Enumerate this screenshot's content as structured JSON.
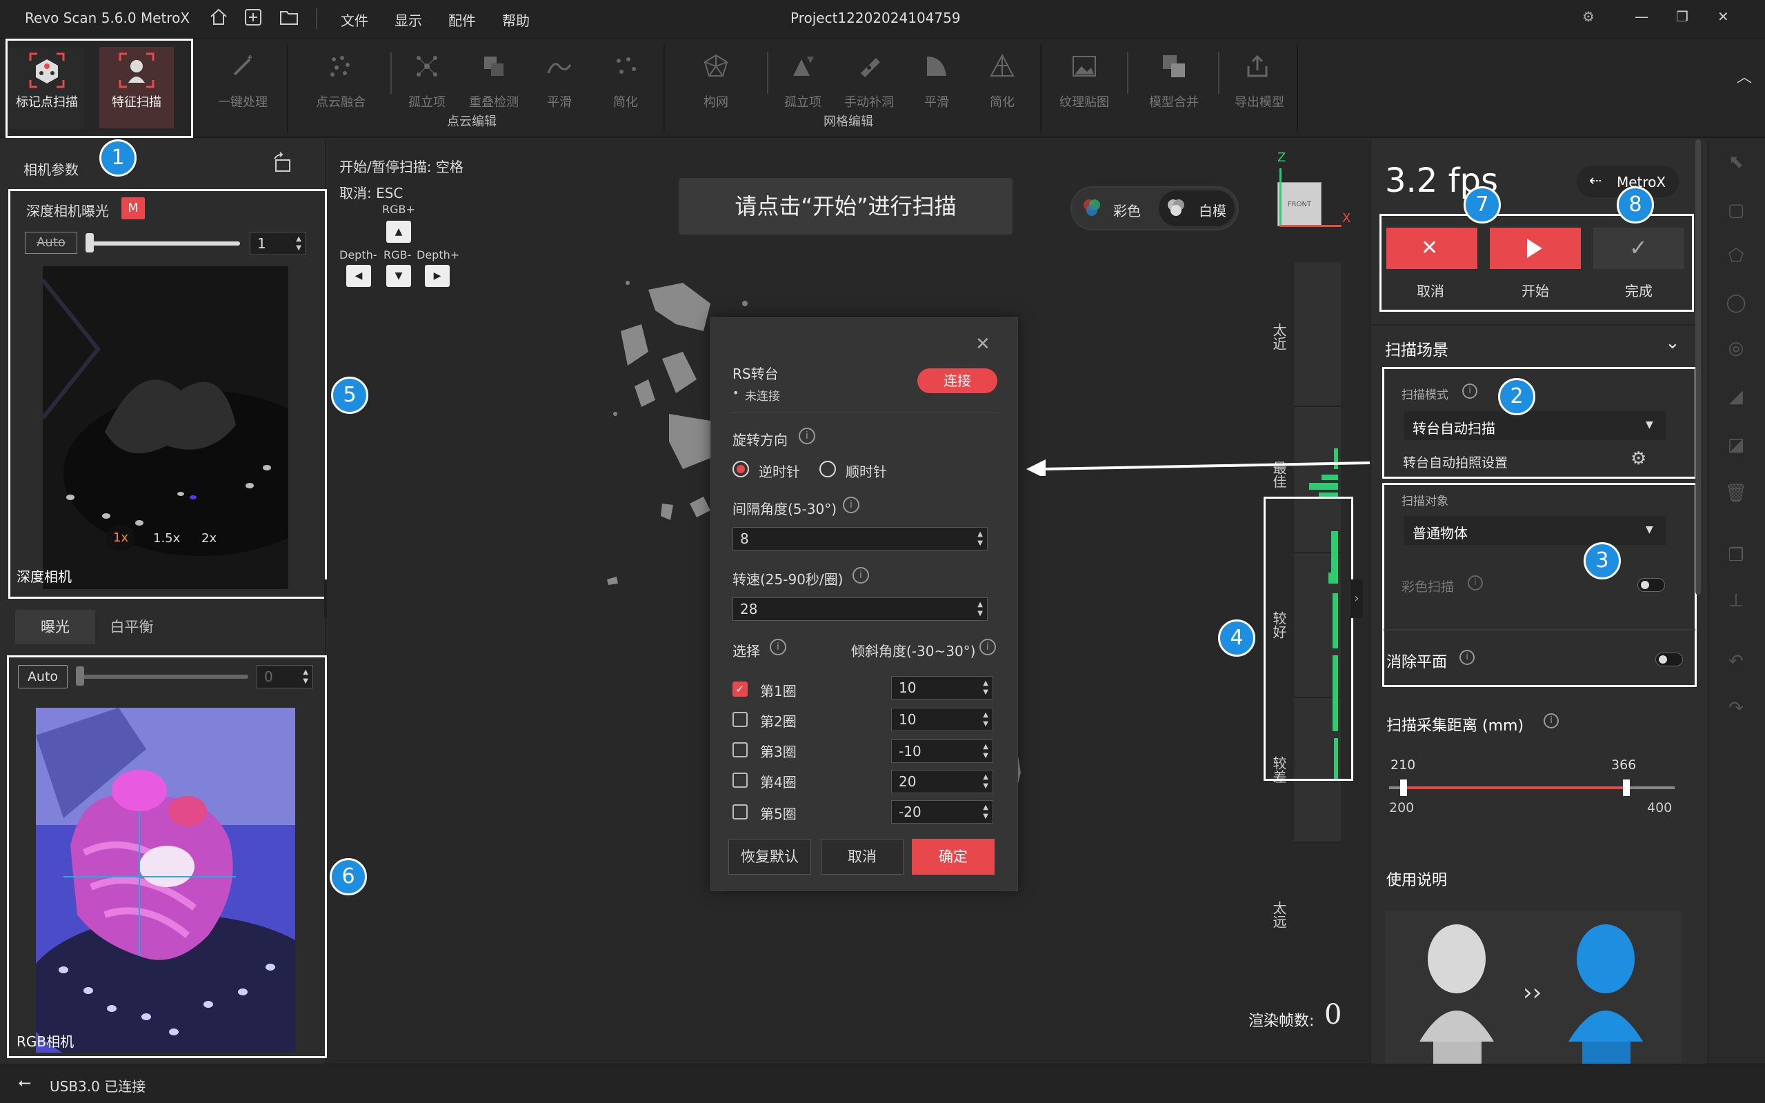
{
  "titlebar": {
    "app_title": "Revo Scan 5.6.0 MetroX",
    "menu": [
      "文件",
      "显示",
      "配件",
      "帮助"
    ],
    "project": "Project12202024104759",
    "win_controls": [
      "⚙",
      "—",
      "❐",
      "✕"
    ]
  },
  "ribbon": {
    "scan_modes": [
      "标记点扫描",
      "特征扫描"
    ],
    "one_click": "一键处理",
    "point_cloud_tools": [
      "点云融合",
      "孤立项",
      "重叠检测",
      "平滑",
      "简化"
    ],
    "point_cloud_group": "点云编辑",
    "mesh_tools": [
      "构网",
      "孤立项",
      "手动补洞",
      "平滑",
      "简化"
    ],
    "mesh_group": "网格编辑",
    "texture": "纹理贴图",
    "merge": "模型合并",
    "export": "导出模型"
  },
  "left": {
    "camera_params": "相机参数",
    "depth_exposure": "深度相机曝光",
    "m_badge": "M",
    "auto_label": "Auto",
    "depth_value": "1",
    "zoom_options": [
      "1x",
      "1.5x",
      "2x"
    ],
    "depth_camera": "深度相机",
    "tab_exposure": "曝光",
    "tab_wb": "白平衡",
    "rgb_auto": "Auto",
    "rgb_value": "0",
    "rgb_camera": "RGB相机"
  },
  "viewport": {
    "start_pause": "开始/暂停扫描: 空格",
    "cancel_hint": "取消:  ESC",
    "rgb_plus": "RGB+",
    "depth_minus": "Depth-",
    "rgb_minus": "RGB-",
    "depth_plus": "Depth+",
    "prompt": "请点击“开始”进行扫描",
    "color_mode": "彩色",
    "white_mode": "白模",
    "front": "FRONT",
    "axis_z": "Z",
    "axis_x": "X",
    "dist_labels": [
      "太近",
      "最佳",
      "较好",
      "较差",
      "太远"
    ],
    "render_fps_label": "渲染帧数:",
    "render_fps": "0"
  },
  "dialog": {
    "turntable": "RS转台",
    "status": "未连接",
    "connect": "连接",
    "rotation": "旋转方向",
    "ccw": "逆时针",
    "cw": "顺时针",
    "interval_label": "间隔角度(5-30°)",
    "interval_value": "8",
    "speed_label": "转速(25-90秒/圈)",
    "speed_value": "28",
    "select": "选择",
    "tilt": "倾斜角度(-30~30°)",
    "rounds": [
      {
        "name": "第1圈",
        "checked": true,
        "value": "10"
      },
      {
        "name": "第2圈",
        "checked": false,
        "value": "10"
      },
      {
        "name": "第3圈",
        "checked": false,
        "value": "-10"
      },
      {
        "name": "第4圈",
        "checked": false,
        "value": "20"
      },
      {
        "name": "第5圈",
        "checked": false,
        "value": "-20"
      }
    ],
    "restore": "恢复默认",
    "cancel": "取消",
    "ok": "确定"
  },
  "right": {
    "fps": "3.2 fps",
    "metrox": "MetroX",
    "cancel": "取消",
    "start": "开始",
    "done": "完成",
    "scene": "扫描场景",
    "scan_mode_label": "扫描模式",
    "scan_mode_value": "转台自动扫描",
    "turntable_settings": "转台自动拍照设置",
    "scan_object_label": "扫描对象",
    "scan_object_value": "普通物体",
    "color_scan": "彩色扫描",
    "remove_plane": "消除平面",
    "distance_title": "扫描采集距离 (mm)",
    "range_low": "210",
    "range_high": "366",
    "min": "200",
    "max": "400",
    "instructions": "使用说明"
  },
  "status": {
    "usb": "USB3.0 已连接"
  },
  "badges": [
    "1",
    "2",
    "3",
    "4",
    "5",
    "6",
    "7",
    "8"
  ],
  "colors": {
    "accent_red": "#e8474b",
    "badge_blue": "#1e8fe0",
    "histogram_green": "#2ecc71"
  }
}
